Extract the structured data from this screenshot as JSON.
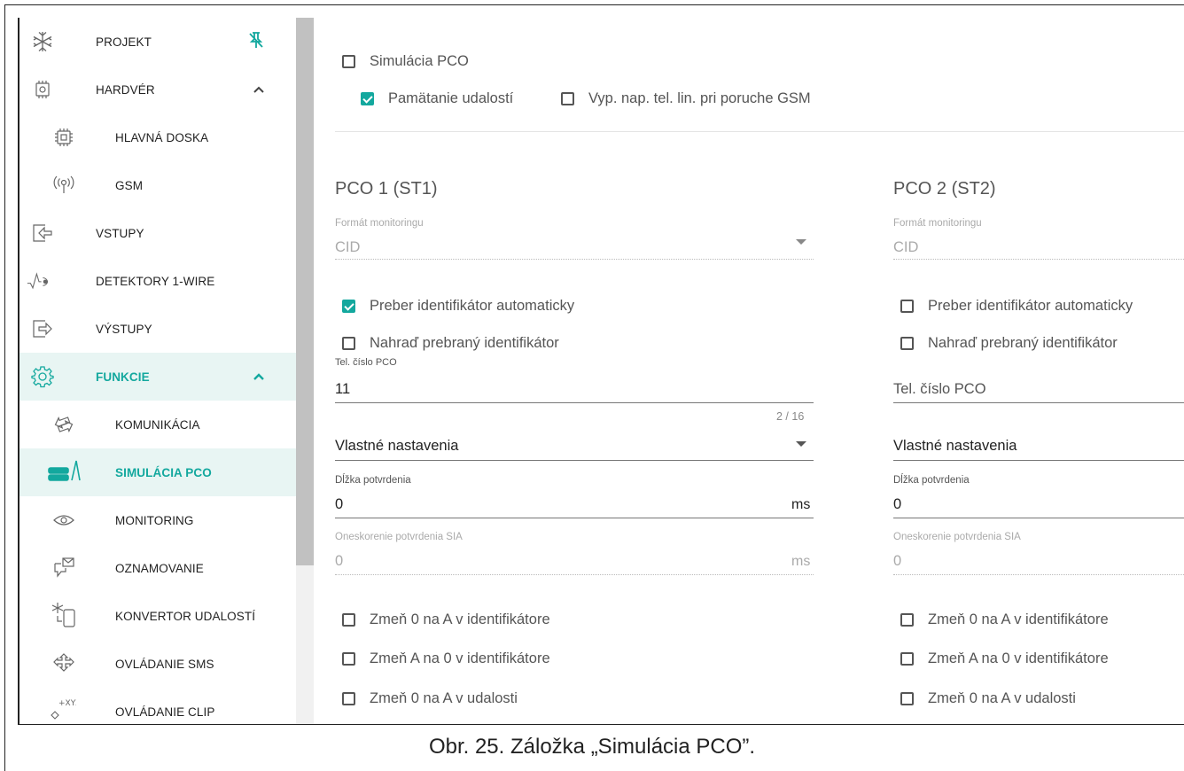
{
  "sidebar": {
    "items": [
      {
        "label": "PROJEKT",
        "icon": "snowflake-icon"
      },
      {
        "label": "HARDVÉR",
        "icon": "chip-icon"
      },
      {
        "label": "HLAVNÁ DOSKA",
        "icon": "board-chip-icon"
      },
      {
        "label": "GSM",
        "icon": "antenna-icon"
      },
      {
        "label": "VSTUPY",
        "icon": "input-icon"
      },
      {
        "label": "DETEKTORY 1-WIRE",
        "icon": "wave-sensor-icon"
      },
      {
        "label": "VÝSTUPY",
        "icon": "output-icon"
      },
      {
        "label": "FUNKCIE",
        "icon": "gear-icon"
      },
      {
        "label": "KOMUNIKÁCIA",
        "icon": "arrows-exchange-icon"
      },
      {
        "label": "SIMULÁCIA PCO",
        "icon": "server-signal-icon"
      },
      {
        "label": "MONITORING",
        "icon": "eye-icon"
      },
      {
        "label": "OZNAMOVANIE",
        "icon": "message-icon"
      },
      {
        "label": "KONVERTOR UDALOSTÍ",
        "icon": "snow-phone-icon"
      },
      {
        "label": "OVLÁDANIE SMS",
        "icon": "sms-control-icon"
      },
      {
        "label": "OVLÁDANIE CLIP",
        "icon": "clip-control-icon"
      }
    ]
  },
  "top": {
    "simulacia_pco": "Simulácia PCO",
    "pamatanie": "Pamätanie udalostí",
    "vyp_nap": "Vyp. nap. tel. lin. pri poruche GSM"
  },
  "pco1": {
    "title": "PCO 1 (ST1)",
    "format_label": "Formát monitoringu",
    "format_value": "CID",
    "preber": "Preber identifikátor automaticky",
    "nahrad": "Nahraď prebraný identifikátor",
    "tel_label": "Tel. číslo PCO",
    "tel_value": "11",
    "counter": "2 / 16",
    "settings": "Vlastné nastavenia",
    "dlzka_label": "Dĺžka potvrdenia",
    "dlzka_value": "0",
    "unit_ms": "ms",
    "onesk_label": "Oneskorenie potvrdenia SIA",
    "onesk_value": "0",
    "zmen1": "Zmeň 0 na A v identifikátore",
    "zmen2": "Zmeň A na 0 v identifikátore",
    "zmen3": "Zmeň 0 na A v udalosti"
  },
  "pco2": {
    "title": "PCO 2 (ST2)",
    "format_label": "Formát monitoringu",
    "format_value": "CID",
    "preber": "Preber identifikátor automaticky",
    "nahrad": "Nahraď prebraný identifikátor",
    "tel_placeholder": "Tel. číslo PCO",
    "settings": "Vlastné nastavenia",
    "dlzka_label": "Dĺžka potvrdenia",
    "dlzka_value": "0",
    "onesk_label": "Oneskorenie potvrdenia SIA",
    "onesk_value": "0",
    "zmen1": "Zmeň 0 na A v identifikátore",
    "zmen2": "Zmeň A na 0 v identifikátore",
    "zmen3": "Zmeň 0 na A v udalosti"
  },
  "caption": "Obr. 25. Záložka „Simulácia PCO”.",
  "colors": {
    "accent": "#13a89e",
    "active_bg": "#e8f5f3"
  }
}
